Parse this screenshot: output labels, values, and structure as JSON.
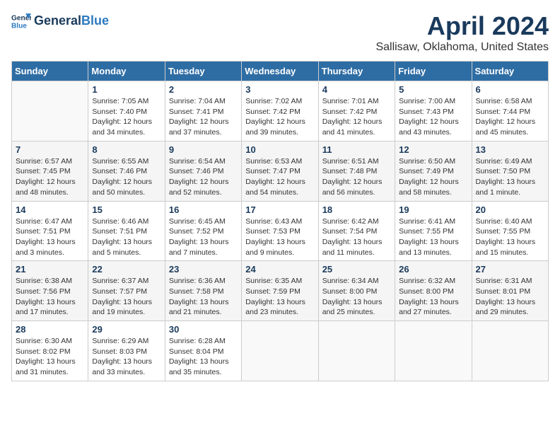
{
  "logo": {
    "line1": "General",
    "line2": "Blue"
  },
  "title": "April 2024",
  "subtitle": "Sallisaw, Oklahoma, United States",
  "headers": [
    "Sunday",
    "Monday",
    "Tuesday",
    "Wednesday",
    "Thursday",
    "Friday",
    "Saturday"
  ],
  "weeks": [
    [
      {
        "day": "",
        "info": ""
      },
      {
        "day": "1",
        "info": "Sunrise: 7:05 AM\nSunset: 7:40 PM\nDaylight: 12 hours\nand 34 minutes."
      },
      {
        "day": "2",
        "info": "Sunrise: 7:04 AM\nSunset: 7:41 PM\nDaylight: 12 hours\nand 37 minutes."
      },
      {
        "day": "3",
        "info": "Sunrise: 7:02 AM\nSunset: 7:42 PM\nDaylight: 12 hours\nand 39 minutes."
      },
      {
        "day": "4",
        "info": "Sunrise: 7:01 AM\nSunset: 7:42 PM\nDaylight: 12 hours\nand 41 minutes."
      },
      {
        "day": "5",
        "info": "Sunrise: 7:00 AM\nSunset: 7:43 PM\nDaylight: 12 hours\nand 43 minutes."
      },
      {
        "day": "6",
        "info": "Sunrise: 6:58 AM\nSunset: 7:44 PM\nDaylight: 12 hours\nand 45 minutes."
      }
    ],
    [
      {
        "day": "7",
        "info": "Sunrise: 6:57 AM\nSunset: 7:45 PM\nDaylight: 12 hours\nand 48 minutes."
      },
      {
        "day": "8",
        "info": "Sunrise: 6:55 AM\nSunset: 7:46 PM\nDaylight: 12 hours\nand 50 minutes."
      },
      {
        "day": "9",
        "info": "Sunrise: 6:54 AM\nSunset: 7:46 PM\nDaylight: 12 hours\nand 52 minutes."
      },
      {
        "day": "10",
        "info": "Sunrise: 6:53 AM\nSunset: 7:47 PM\nDaylight: 12 hours\nand 54 minutes."
      },
      {
        "day": "11",
        "info": "Sunrise: 6:51 AM\nSunset: 7:48 PM\nDaylight: 12 hours\nand 56 minutes."
      },
      {
        "day": "12",
        "info": "Sunrise: 6:50 AM\nSunset: 7:49 PM\nDaylight: 12 hours\nand 58 minutes."
      },
      {
        "day": "13",
        "info": "Sunrise: 6:49 AM\nSunset: 7:50 PM\nDaylight: 13 hours\nand 1 minute."
      }
    ],
    [
      {
        "day": "14",
        "info": "Sunrise: 6:47 AM\nSunset: 7:51 PM\nDaylight: 13 hours\nand 3 minutes."
      },
      {
        "day": "15",
        "info": "Sunrise: 6:46 AM\nSunset: 7:51 PM\nDaylight: 13 hours\nand 5 minutes."
      },
      {
        "day": "16",
        "info": "Sunrise: 6:45 AM\nSunset: 7:52 PM\nDaylight: 13 hours\nand 7 minutes."
      },
      {
        "day": "17",
        "info": "Sunrise: 6:43 AM\nSunset: 7:53 PM\nDaylight: 13 hours\nand 9 minutes."
      },
      {
        "day": "18",
        "info": "Sunrise: 6:42 AM\nSunset: 7:54 PM\nDaylight: 13 hours\nand 11 minutes."
      },
      {
        "day": "19",
        "info": "Sunrise: 6:41 AM\nSunset: 7:55 PM\nDaylight: 13 hours\nand 13 minutes."
      },
      {
        "day": "20",
        "info": "Sunrise: 6:40 AM\nSunset: 7:55 PM\nDaylight: 13 hours\nand 15 minutes."
      }
    ],
    [
      {
        "day": "21",
        "info": "Sunrise: 6:38 AM\nSunset: 7:56 PM\nDaylight: 13 hours\nand 17 minutes."
      },
      {
        "day": "22",
        "info": "Sunrise: 6:37 AM\nSunset: 7:57 PM\nDaylight: 13 hours\nand 19 minutes."
      },
      {
        "day": "23",
        "info": "Sunrise: 6:36 AM\nSunset: 7:58 PM\nDaylight: 13 hours\nand 21 minutes."
      },
      {
        "day": "24",
        "info": "Sunrise: 6:35 AM\nSunset: 7:59 PM\nDaylight: 13 hours\nand 23 minutes."
      },
      {
        "day": "25",
        "info": "Sunrise: 6:34 AM\nSunset: 8:00 PM\nDaylight: 13 hours\nand 25 minutes."
      },
      {
        "day": "26",
        "info": "Sunrise: 6:32 AM\nSunset: 8:00 PM\nDaylight: 13 hours\nand 27 minutes."
      },
      {
        "day": "27",
        "info": "Sunrise: 6:31 AM\nSunset: 8:01 PM\nDaylight: 13 hours\nand 29 minutes."
      }
    ],
    [
      {
        "day": "28",
        "info": "Sunrise: 6:30 AM\nSunset: 8:02 PM\nDaylight: 13 hours\nand 31 minutes."
      },
      {
        "day": "29",
        "info": "Sunrise: 6:29 AM\nSunset: 8:03 PM\nDaylight: 13 hours\nand 33 minutes."
      },
      {
        "day": "30",
        "info": "Sunrise: 6:28 AM\nSunset: 8:04 PM\nDaylight: 13 hours\nand 35 minutes."
      },
      {
        "day": "",
        "info": ""
      },
      {
        "day": "",
        "info": ""
      },
      {
        "day": "",
        "info": ""
      },
      {
        "day": "",
        "info": ""
      }
    ]
  ]
}
